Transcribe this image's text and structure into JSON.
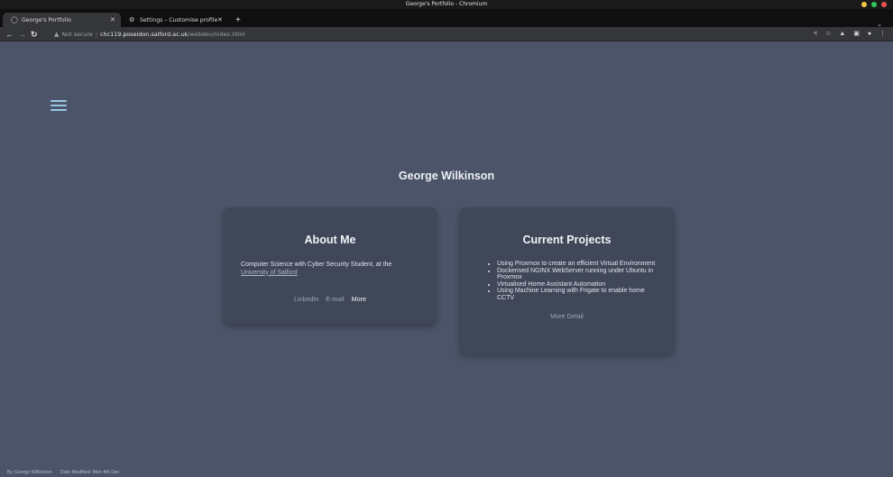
{
  "window": {
    "title": "George's Portfolio - Chromium",
    "controls": {
      "minimize_color": "#f2c744",
      "maximize_color": "#2ec95c",
      "close_color": "#ee5452"
    }
  },
  "tabs": [
    {
      "label": "George's Portfolio",
      "icon": "globe-icon",
      "active": true
    },
    {
      "label": "Settings – Customise profile",
      "icon": "gear-icon",
      "active": false
    }
  ],
  "toolbar": {
    "security_label": "Not secure",
    "url_host": "chc119.poseidon.salford.ac.uk",
    "url_path": "/webdev/index.html"
  },
  "page": {
    "heading": "George Wilkinson",
    "about": {
      "title": "About Me",
      "description": "Computer Science with Cyber Security Student, at the",
      "university_link": "University of Salford",
      "links": [
        "LinkedIn",
        "E-mail",
        "More"
      ]
    },
    "projects": {
      "title": "Current Projects",
      "items": [
        "Using Proxmox to create an efficient Virtual Environment",
        "Dockerised NGINX WebServer running under Ubuntu in Proxmox",
        "Virtualised Home Assistant Automation",
        "Using Machine Learning with Frigate to enable home CCTV"
      ],
      "more_label": "More Detail"
    },
    "footer": {
      "author": "By George Wilkinson",
      "modified": "Date Modified: Mon 4th Dec"
    }
  },
  "colors": {
    "page_bg": "#4b5468",
    "card_bg": "#3f4759",
    "accent": "#9bc6e6"
  }
}
